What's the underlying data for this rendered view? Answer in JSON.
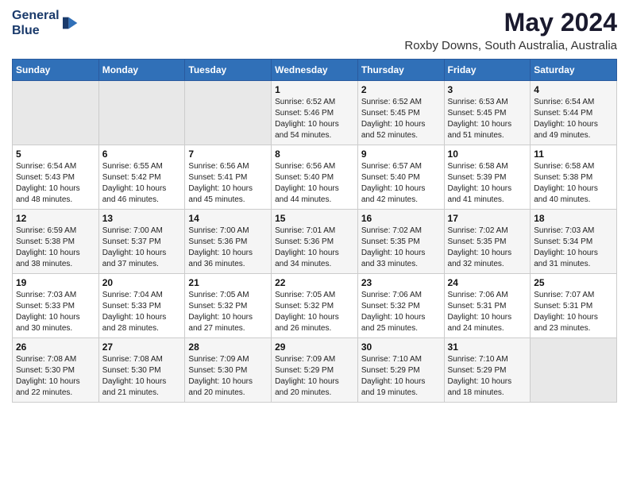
{
  "logo": {
    "line1": "General",
    "line2": "Blue"
  },
  "title": "May 2024",
  "subtitle": "Roxby Downs, South Australia, Australia",
  "days_header": [
    "Sunday",
    "Monday",
    "Tuesday",
    "Wednesday",
    "Thursday",
    "Friday",
    "Saturday"
  ],
  "weeks": [
    [
      {
        "day": "",
        "info": ""
      },
      {
        "day": "",
        "info": ""
      },
      {
        "day": "",
        "info": ""
      },
      {
        "day": "1",
        "info": "Sunrise: 6:52 AM\nSunset: 5:46 PM\nDaylight: 10 hours\nand 54 minutes."
      },
      {
        "day": "2",
        "info": "Sunrise: 6:52 AM\nSunset: 5:45 PM\nDaylight: 10 hours\nand 52 minutes."
      },
      {
        "day": "3",
        "info": "Sunrise: 6:53 AM\nSunset: 5:45 PM\nDaylight: 10 hours\nand 51 minutes."
      },
      {
        "day": "4",
        "info": "Sunrise: 6:54 AM\nSunset: 5:44 PM\nDaylight: 10 hours\nand 49 minutes."
      }
    ],
    [
      {
        "day": "5",
        "info": "Sunrise: 6:54 AM\nSunset: 5:43 PM\nDaylight: 10 hours\nand 48 minutes."
      },
      {
        "day": "6",
        "info": "Sunrise: 6:55 AM\nSunset: 5:42 PM\nDaylight: 10 hours\nand 46 minutes."
      },
      {
        "day": "7",
        "info": "Sunrise: 6:56 AM\nSunset: 5:41 PM\nDaylight: 10 hours\nand 45 minutes."
      },
      {
        "day": "8",
        "info": "Sunrise: 6:56 AM\nSunset: 5:40 PM\nDaylight: 10 hours\nand 44 minutes."
      },
      {
        "day": "9",
        "info": "Sunrise: 6:57 AM\nSunset: 5:40 PM\nDaylight: 10 hours\nand 42 minutes."
      },
      {
        "day": "10",
        "info": "Sunrise: 6:58 AM\nSunset: 5:39 PM\nDaylight: 10 hours\nand 41 minutes."
      },
      {
        "day": "11",
        "info": "Sunrise: 6:58 AM\nSunset: 5:38 PM\nDaylight: 10 hours\nand 40 minutes."
      }
    ],
    [
      {
        "day": "12",
        "info": "Sunrise: 6:59 AM\nSunset: 5:38 PM\nDaylight: 10 hours\nand 38 minutes."
      },
      {
        "day": "13",
        "info": "Sunrise: 7:00 AM\nSunset: 5:37 PM\nDaylight: 10 hours\nand 37 minutes."
      },
      {
        "day": "14",
        "info": "Sunrise: 7:00 AM\nSunset: 5:36 PM\nDaylight: 10 hours\nand 36 minutes."
      },
      {
        "day": "15",
        "info": "Sunrise: 7:01 AM\nSunset: 5:36 PM\nDaylight: 10 hours\nand 34 minutes."
      },
      {
        "day": "16",
        "info": "Sunrise: 7:02 AM\nSunset: 5:35 PM\nDaylight: 10 hours\nand 33 minutes."
      },
      {
        "day": "17",
        "info": "Sunrise: 7:02 AM\nSunset: 5:35 PM\nDaylight: 10 hours\nand 32 minutes."
      },
      {
        "day": "18",
        "info": "Sunrise: 7:03 AM\nSunset: 5:34 PM\nDaylight: 10 hours\nand 31 minutes."
      }
    ],
    [
      {
        "day": "19",
        "info": "Sunrise: 7:03 AM\nSunset: 5:33 PM\nDaylight: 10 hours\nand 30 minutes."
      },
      {
        "day": "20",
        "info": "Sunrise: 7:04 AM\nSunset: 5:33 PM\nDaylight: 10 hours\nand 28 minutes."
      },
      {
        "day": "21",
        "info": "Sunrise: 7:05 AM\nSunset: 5:32 PM\nDaylight: 10 hours\nand 27 minutes."
      },
      {
        "day": "22",
        "info": "Sunrise: 7:05 AM\nSunset: 5:32 PM\nDaylight: 10 hours\nand 26 minutes."
      },
      {
        "day": "23",
        "info": "Sunrise: 7:06 AM\nSunset: 5:32 PM\nDaylight: 10 hours\nand 25 minutes."
      },
      {
        "day": "24",
        "info": "Sunrise: 7:06 AM\nSunset: 5:31 PM\nDaylight: 10 hours\nand 24 minutes."
      },
      {
        "day": "25",
        "info": "Sunrise: 7:07 AM\nSunset: 5:31 PM\nDaylight: 10 hours\nand 23 minutes."
      }
    ],
    [
      {
        "day": "26",
        "info": "Sunrise: 7:08 AM\nSunset: 5:30 PM\nDaylight: 10 hours\nand 22 minutes."
      },
      {
        "day": "27",
        "info": "Sunrise: 7:08 AM\nSunset: 5:30 PM\nDaylight: 10 hours\nand 21 minutes."
      },
      {
        "day": "28",
        "info": "Sunrise: 7:09 AM\nSunset: 5:30 PM\nDaylight: 10 hours\nand 20 minutes."
      },
      {
        "day": "29",
        "info": "Sunrise: 7:09 AM\nSunset: 5:29 PM\nDaylight: 10 hours\nand 20 minutes."
      },
      {
        "day": "30",
        "info": "Sunrise: 7:10 AM\nSunset: 5:29 PM\nDaylight: 10 hours\nand 19 minutes."
      },
      {
        "day": "31",
        "info": "Sunrise: 7:10 AM\nSunset: 5:29 PM\nDaylight: 10 hours\nand 18 minutes."
      },
      {
        "day": "",
        "info": ""
      }
    ]
  ]
}
